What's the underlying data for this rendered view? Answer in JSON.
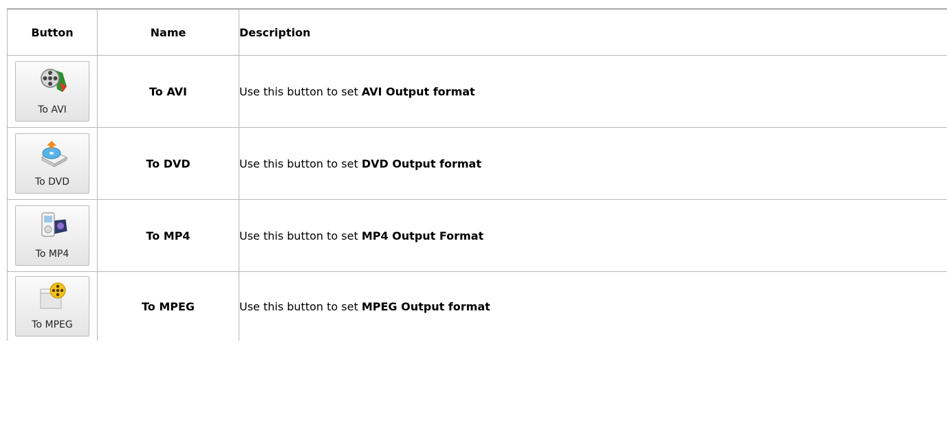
{
  "headers": {
    "button": "Button",
    "name": "Name",
    "description": "Description"
  },
  "rows": [
    {
      "button_label": "To AVI",
      "icon": "film-reel-icon",
      "name": "To AVI",
      "desc_prefix": "Use this button to set ",
      "desc_bold": "AVI Output format"
    },
    {
      "button_label": "To DVD",
      "icon": "dvd-drive-icon",
      "name": "To DVD",
      "desc_prefix": "Use this button to set ",
      "desc_bold": "DVD Output format"
    },
    {
      "button_label": "To MP4",
      "icon": "mp4-player-icon",
      "name": "To MP4",
      "desc_prefix": "Use this button to set ",
      "desc_bold": "MP4 Output Format"
    },
    {
      "button_label": "To MPEG",
      "icon": "mpeg-folder-icon",
      "name": "To MPEG",
      "desc_prefix": "Use this button to set ",
      "desc_bold": "MPEG Output format"
    }
  ]
}
